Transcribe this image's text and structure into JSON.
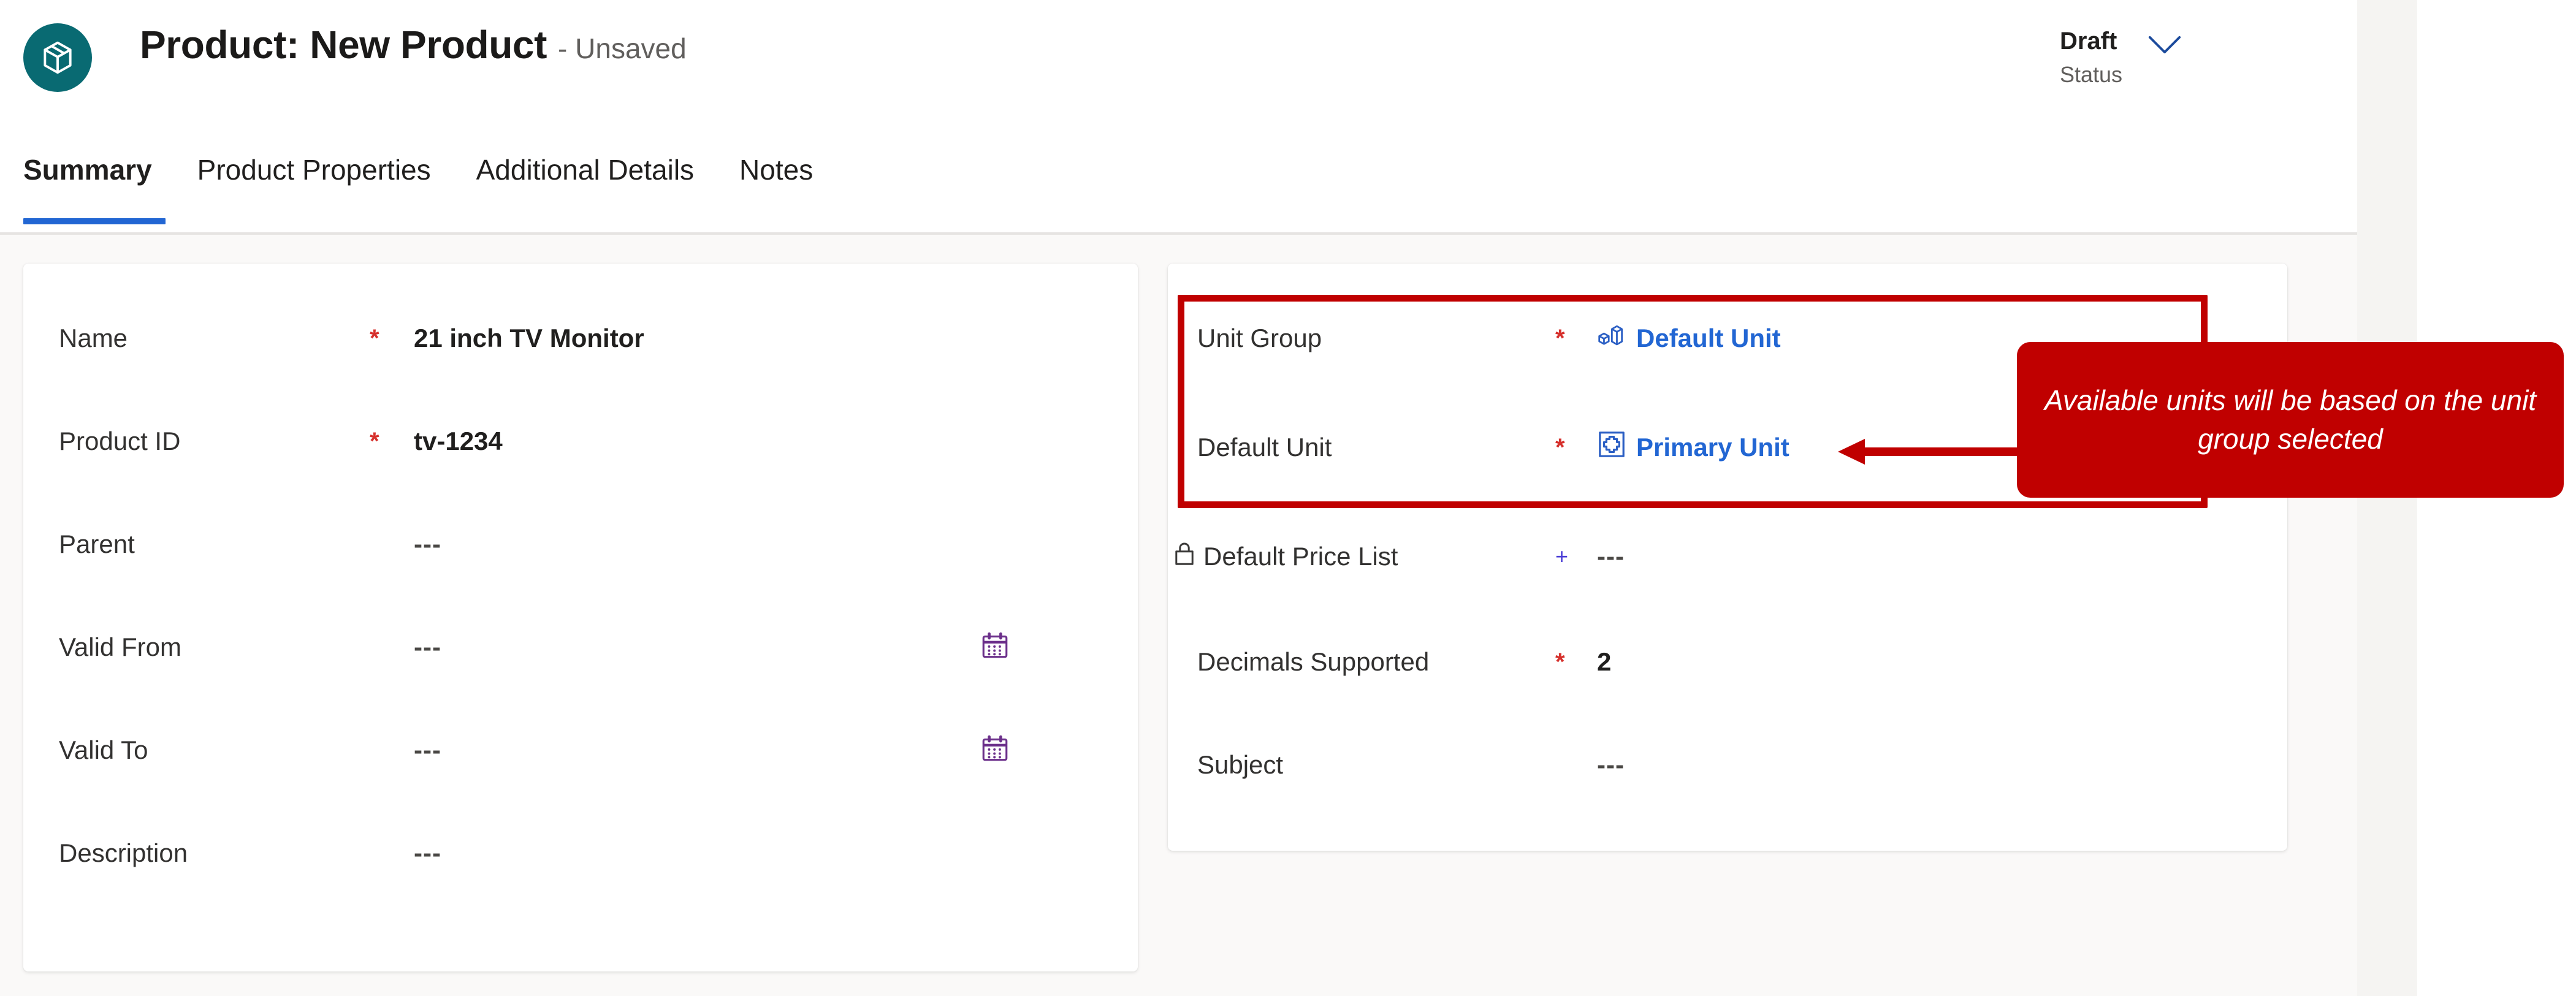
{
  "header": {
    "entity_icon": "product-cube-icon",
    "title": "Product: New Product",
    "unsaved_state": "- Unsaved",
    "status_value": "Draft",
    "status_label": "Status",
    "chevron_icon": "chevron-down-icon"
  },
  "tabs": [
    {
      "label": "Summary",
      "active": true
    },
    {
      "label": "Product Properties",
      "active": false
    },
    {
      "label": "Additional Details",
      "active": false
    },
    {
      "label": "Notes",
      "active": false
    }
  ],
  "left_card": {
    "fields": [
      {
        "label": "Name",
        "required": "*",
        "value": "21 inch TV Monitor",
        "empty": false,
        "trailing_icon": ""
      },
      {
        "label": "Product ID",
        "required": "*",
        "value": "tv-1234",
        "empty": false,
        "trailing_icon": ""
      },
      {
        "label": "Parent",
        "required": "",
        "value": "---",
        "empty": true,
        "trailing_icon": ""
      },
      {
        "label": "Valid From",
        "required": "",
        "value": "---",
        "empty": true,
        "trailing_icon": "calendar-icon"
      },
      {
        "label": "Valid To",
        "required": "",
        "value": "---",
        "empty": true,
        "trailing_icon": "calendar-icon"
      },
      {
        "label": "Description",
        "required": "",
        "value": "---",
        "empty": true,
        "trailing_icon": ""
      }
    ]
  },
  "right_card": {
    "fields": [
      {
        "label": "Unit Group",
        "required": "*",
        "value": "Default Unit",
        "empty": false,
        "link": true,
        "lead_icon": "unit-group-icon",
        "lock": false
      },
      {
        "label": "Default Unit",
        "required": "*",
        "value": "Primary Unit",
        "empty": false,
        "link": true,
        "lead_icon": "primary-unit-icon",
        "lock": false
      },
      {
        "label": "Default Price List",
        "required": "+",
        "value": "---",
        "empty": true,
        "link": false,
        "lead_icon": "",
        "lock": true
      },
      {
        "label": "Decimals Supported",
        "required": "*",
        "value": "2",
        "empty": false,
        "link": false,
        "lead_icon": "",
        "lock": false
      },
      {
        "label": "Subject",
        "required": "",
        "value": "---",
        "empty": true,
        "link": false,
        "lead_icon": "",
        "lock": false
      }
    ]
  },
  "annotation": {
    "callout_text": "Available units will be based on the unit group selected",
    "arrow_icon": "left-arrow-icon",
    "color": "#c00000"
  },
  "colors": {
    "entity_icon_bg": "#096a72",
    "tab_active_underline": "#2266d3",
    "required_asterisk": "#d6302c",
    "link_text": "#2266d3",
    "annotation_red": "#c00000",
    "page_bg": "#faf9f8"
  }
}
